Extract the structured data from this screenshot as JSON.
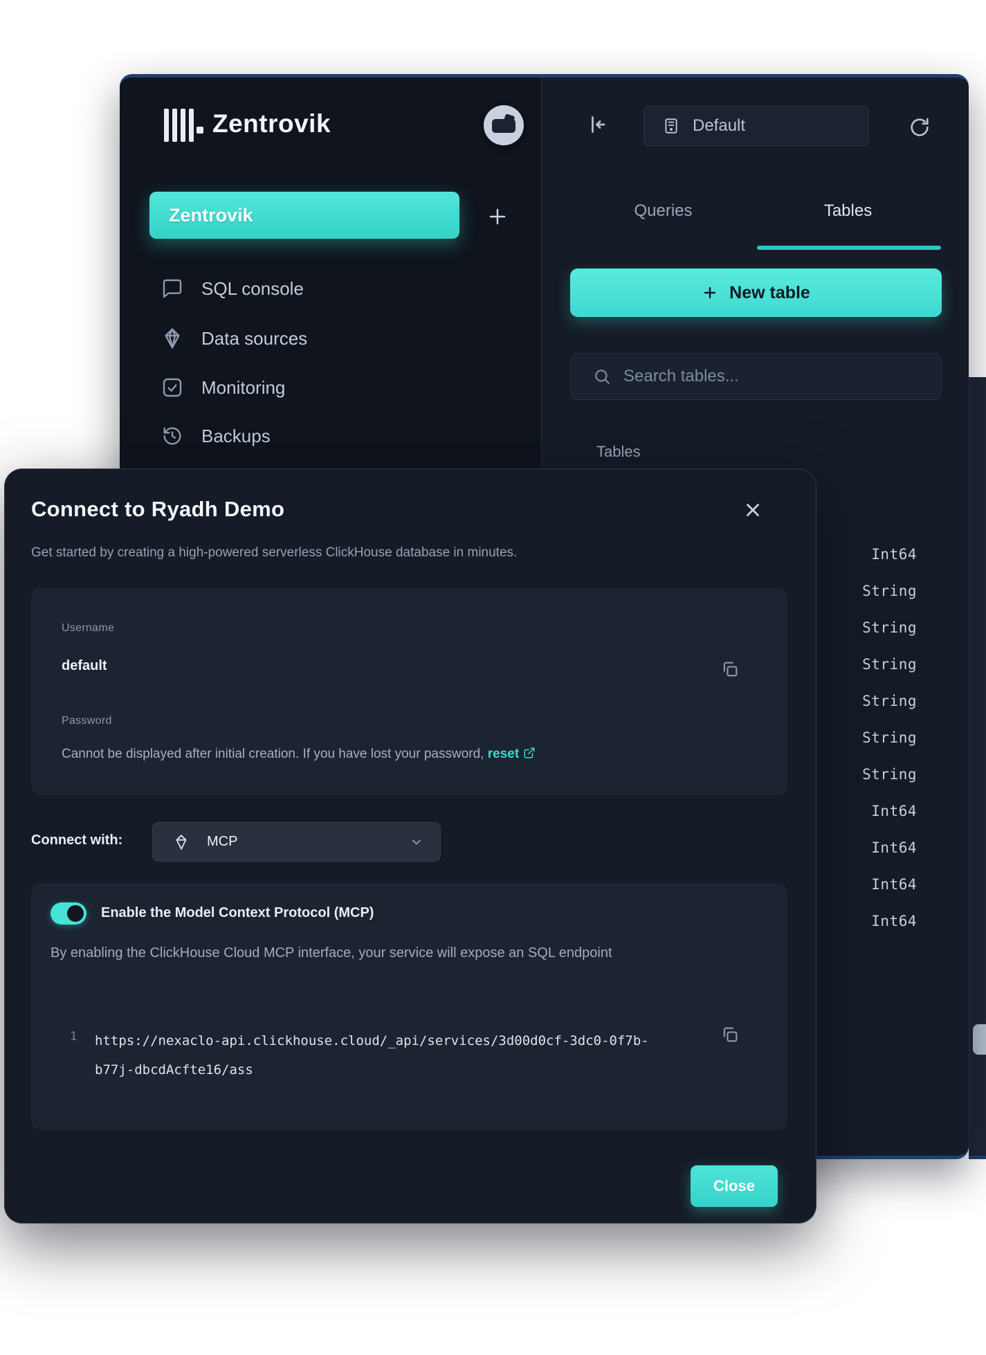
{
  "colors": {
    "teal_accent": "#3fdcd2",
    "window_bg": "#151b27",
    "sidebar_bg": "#0f141d",
    "card_bg": "#1c2431",
    "page_bg": "#ffffff"
  },
  "sidebar": {
    "brand": "Zentrovik",
    "selected_item": "Zentrovik",
    "items": [
      {
        "label": "SQL console",
        "icon": "console-icon"
      },
      {
        "label": "Data sources",
        "icon": "data-sources-icon"
      },
      {
        "label": "Monitoring",
        "icon": "monitoring-icon"
      },
      {
        "label": "Backups",
        "icon": "backups-icon"
      }
    ]
  },
  "topbar": {
    "database_selector": "Default"
  },
  "panel": {
    "tabs": [
      {
        "label": "Queries"
      },
      {
        "label": "Tables"
      }
    ],
    "active_tab": "Tables",
    "new_table_label": "New table",
    "search_placeholder": "Search tables...",
    "section_label": "Tables",
    "rows": [
      {
        "type": "Int64"
      },
      {
        "type": "String"
      },
      {
        "type": "String"
      },
      {
        "type": "String"
      },
      {
        "type": "String"
      },
      {
        "type": "String"
      },
      {
        "type": "String"
      },
      {
        "type": "Int64"
      },
      {
        "type": "Int64"
      },
      {
        "type": "Int64"
      },
      {
        "type": "Int64"
      }
    ]
  },
  "modal": {
    "title": "Connect to Ryadh Demo",
    "subtitle": "Get started by creating a high-powered serverless ClickHouse database in minutes.",
    "username_label": "Username",
    "username_value": "default",
    "password_label": "Password",
    "password_note": "Cannot be displayed after initial creation. If you have lost your password,",
    "password_reset_link": "reset",
    "connect_with_label": "Connect with:",
    "connect_selector_value": "MCP",
    "mcp_toggle_label": "Enable the Model Context Protocol (MCP)",
    "mcp_toggle_state": "on",
    "mcp_description": "By enabling the ClickHouse Cloud MCP interface, your service will expose an SQL endpoint",
    "code_line_number": "1",
    "code_line1": "https://nexaclo-api.clickhouse.cloud/_api/services/3d00d0cf-3dc0-0f7b-",
    "code_line2": "b77j-dbcdAcfte16/ass",
    "close_button_label": "Close"
  }
}
